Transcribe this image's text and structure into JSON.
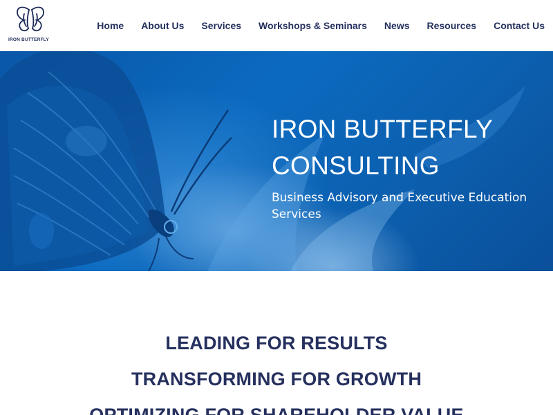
{
  "brand": {
    "logo_text": "IRON BUTTERFLY",
    "logo_icon": "butterfly-icon",
    "color": "#1d2a57"
  },
  "nav": {
    "items": [
      {
        "label": "Home"
      },
      {
        "label": "About Us"
      },
      {
        "label": "Services"
      },
      {
        "label": "Workshops & Seminars"
      },
      {
        "label": "News"
      },
      {
        "label": "Resources"
      },
      {
        "label": "Contact Us"
      }
    ],
    "text_color": "#25305e"
  },
  "hero": {
    "title_line1": "IRON BUTTERFLY",
    "title_line2": "CONSULTING",
    "subtitle": "Business Advisory and Executive Education Services",
    "background_color": "#0b62b6"
  },
  "taglines": [
    {
      "text": "LEADING FOR RESULTS"
    },
    {
      "text": "TRANSFORMING FOR GROWTH"
    },
    {
      "text": "OPTIMIZING FOR SHAREHOLDER VALUE"
    }
  ]
}
